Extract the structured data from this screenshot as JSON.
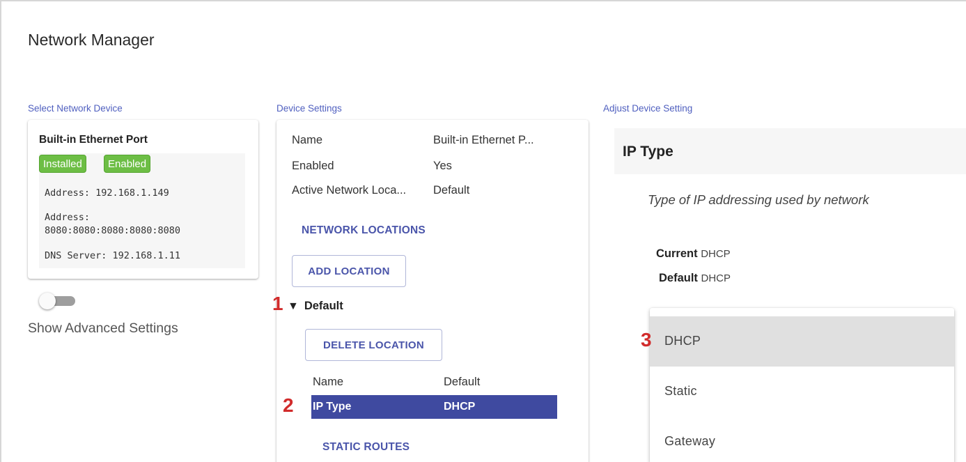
{
  "app": {
    "title": "Network Manager"
  },
  "sections": {
    "select_device": "Select Network Device",
    "device_settings": "Device Settings",
    "adjust_setting": "Adjust Device Setting"
  },
  "device": {
    "name": "Built-in Ethernet Port",
    "badges": [
      "Installed",
      "Enabled"
    ],
    "badge_color": "#6dbe45",
    "address1": "Address: 192.168.1.149",
    "address2_label": "Address:",
    "address2_value": "8080:8080:8080:8080:8080",
    "dns": "DNS Server: 192.168.1.11"
  },
  "advanced": {
    "label": "Show Advanced Settings",
    "enabled": false
  },
  "settings": {
    "props": [
      {
        "label": "Name",
        "value": "Built-in Ethernet P..."
      },
      {
        "label": "Enabled",
        "value": "Yes"
      },
      {
        "label": "Active Network Loca...",
        "value": "Default"
      }
    ],
    "network_locations_heading": "NETWORK LOCATIONS",
    "add_location_label": "ADD LOCATION",
    "location_node": "Default",
    "delete_location_label": "DELETE LOCATION",
    "location_props": [
      {
        "label": "Name",
        "value": "Default"
      },
      {
        "label": "IP Type",
        "value": "DHCP"
      }
    ],
    "static_routes_heading": "STATIC ROUTES",
    "selected_row_color": "#3f4aa0"
  },
  "adjust": {
    "title": "IP Type",
    "description": "Type of IP addressing used by network",
    "current_label": "Current",
    "current_value": "DHCP",
    "default_label": "Default",
    "default_value": "DHCP",
    "options": [
      "DHCP",
      "Static",
      "Gateway"
    ],
    "selected_option": "DHCP"
  },
  "callouts": [
    "1",
    "2",
    "3"
  ],
  "accent_color": "#4a55aa",
  "callout_color": "#d12b2b"
}
